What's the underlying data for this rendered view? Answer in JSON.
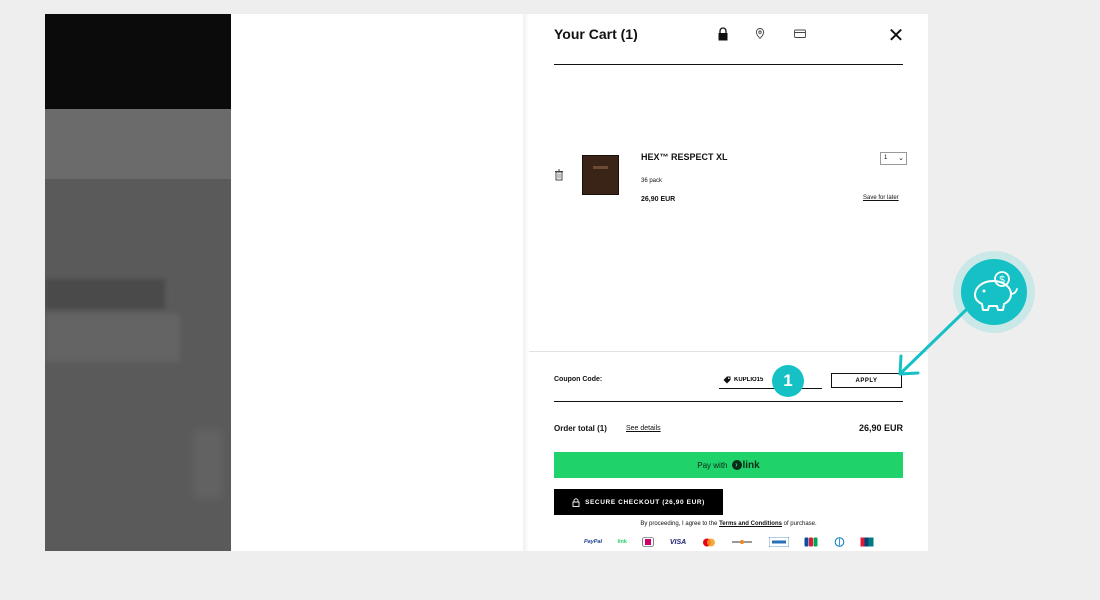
{
  "cart": {
    "title": "Your Cart (1)",
    "step_icons": [
      "bag-icon",
      "location-pin-icon",
      "credit-card-icon"
    ]
  },
  "item": {
    "name": "HEX™ RESPECT XL",
    "variant": "36 pack",
    "price": "26,90 EUR",
    "quantity": "1",
    "save_for_later": "Save for later"
  },
  "coupon": {
    "label": "Coupon Code:",
    "value": "KUPLIO15",
    "apply_label": "APPLY"
  },
  "annotation": {
    "badge_number": "1",
    "accent_color": "#15c1c5"
  },
  "order": {
    "total_label": "Order total (1)",
    "see_details": "See details",
    "total_value": "26,90 EUR"
  },
  "pay_link": {
    "prefix": "Pay with",
    "brand": "link",
    "color": "#1fd26a"
  },
  "checkout": {
    "label": "SECURE CHECKOUT (26,90 EUR)"
  },
  "legal": {
    "prefix": "By proceeding, I agree to the",
    "link": "Terms and Conditions",
    "suffix": "of purchase."
  },
  "payment_methods": [
    "PayPal",
    "link",
    "iDEAL",
    "VISA",
    "Mastercard",
    "Discover",
    "AMEX",
    "JCB",
    "Diners Club",
    "UnionPay"
  ]
}
